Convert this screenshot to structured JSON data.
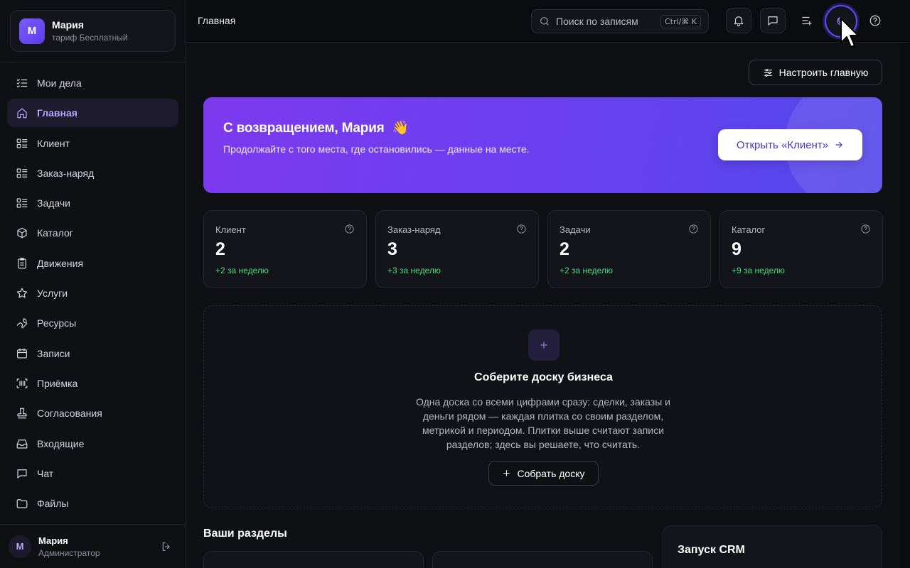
{
  "workspace": {
    "initial": "М",
    "name": "Мария",
    "plan": "тариф Бесплатный"
  },
  "nav": [
    {
      "label": "Мои дела",
      "icon": "checklist-icon",
      "active": false
    },
    {
      "label": "Главная",
      "icon": "home-icon",
      "active": true
    },
    {
      "label": "Клиент",
      "icon": "list-icon",
      "active": false
    },
    {
      "label": "Заказ-наряд",
      "icon": "list-icon",
      "active": false
    },
    {
      "label": "Задачи",
      "icon": "list-icon",
      "active": false
    },
    {
      "label": "Каталог",
      "icon": "box-icon",
      "active": false
    },
    {
      "label": "Движения",
      "icon": "clipboard-icon",
      "active": false
    },
    {
      "label": "Услуги",
      "icon": "star-icon",
      "active": false
    },
    {
      "label": "Ресурсы",
      "icon": "wrench-icon",
      "active": false
    },
    {
      "label": "Записи",
      "icon": "calendar-icon",
      "active": false
    },
    {
      "label": "Приёмка",
      "icon": "barcode-scan-icon",
      "active": false
    },
    {
      "label": "Согласования",
      "icon": "stamp-icon",
      "active": false
    },
    {
      "label": "Входящие",
      "icon": "inbox-icon",
      "active": false
    },
    {
      "label": "Чат",
      "icon": "chat-icon",
      "active": false
    },
    {
      "label": "Файлы",
      "icon": "folder-icon",
      "active": false
    }
  ],
  "user": {
    "initial": "М",
    "name": "Мария",
    "role": "Администратор"
  },
  "topbar": {
    "breadcrumb": "Главная",
    "search_placeholder": "Поиск по записям",
    "search_shortcut": "Ctrl/⌘ K"
  },
  "main": {
    "customize_label": "Настроить главную",
    "hero": {
      "title": "С возвращением, Мария",
      "emoji": "👋",
      "subtitle": "Продолжайте с того места, где остановились — данные на месте.",
      "button_label": "Открыть «Клиент»"
    },
    "stats": [
      {
        "label": "Клиент",
        "value": "2",
        "delta": "+2 за неделю"
      },
      {
        "label": "Заказ-наряд",
        "value": "3",
        "delta": "+3 за неделю"
      },
      {
        "label": "Задачи",
        "value": "2",
        "delta": "+2 за неделю"
      },
      {
        "label": "Каталог",
        "value": "9",
        "delta": "+9 за неделю"
      }
    ],
    "board": {
      "title": "Соберите доску бизнеса",
      "description": "Одна доска со всеми цифрами сразу: сделки, заказы и деньги рядом — каждая плитка со своим разделом, метрикой и периодом. Плитки выше считают записи разделов; здесь вы решаете, что считать.",
      "button_label": "Собрать доску"
    },
    "sections_title": "Ваши разделы",
    "launch_title": "Запуск CRM"
  },
  "colors": {
    "accent": "#7c5cff",
    "positive": "#4ade80",
    "hero_start": "#7c3aed",
    "hero_end": "#5347ea"
  }
}
